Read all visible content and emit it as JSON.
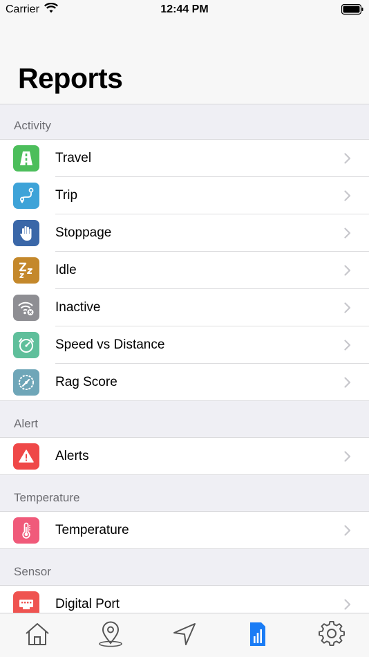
{
  "status_bar": {
    "carrier": "Carrier",
    "time": "12:44 PM"
  },
  "header": {
    "title": "Reports"
  },
  "sections": [
    {
      "title": "Activity",
      "items": [
        {
          "label": "Travel",
          "icon": "road-icon",
          "color": "#4cbe5b"
        },
        {
          "label": "Trip",
          "icon": "route-pin-icon",
          "color": "#3ea3d8"
        },
        {
          "label": "Stoppage",
          "icon": "hand-stop-icon",
          "color": "#3a67a8"
        },
        {
          "label": "Idle",
          "icon": "sleep-zzz-icon",
          "color": "#c4882b"
        },
        {
          "label": "Inactive",
          "icon": "no-signal-icon",
          "color": "#8e8e93"
        },
        {
          "label": "Speed vs Distance",
          "icon": "speed-distance-icon",
          "color": "#5fbf9b"
        },
        {
          "label": "Rag Score",
          "icon": "gauge-icon",
          "color": "#6fa6b8"
        }
      ]
    },
    {
      "title": "Alert",
      "items": [
        {
          "label": "Alerts",
          "icon": "warning-icon",
          "color": "#ef4848"
        }
      ]
    },
    {
      "title": "Temperature",
      "items": [
        {
          "label": "Temperature",
          "icon": "thermometer-icon",
          "color": "#f05a7a"
        }
      ]
    },
    {
      "title": "Sensor",
      "items": [
        {
          "label": "Digital Port",
          "icon": "port-icon",
          "color": "#ef5350"
        }
      ]
    }
  ],
  "tab_bar": {
    "tabs": [
      {
        "name": "home-icon",
        "active": false
      },
      {
        "name": "location-pin-icon",
        "active": false
      },
      {
        "name": "navigation-arrow-icon",
        "active": false
      },
      {
        "name": "reports-icon",
        "active": true
      },
      {
        "name": "settings-gear-icon",
        "active": false
      }
    ],
    "active_color": "#1a7cf5",
    "inactive_color": "#555555"
  }
}
